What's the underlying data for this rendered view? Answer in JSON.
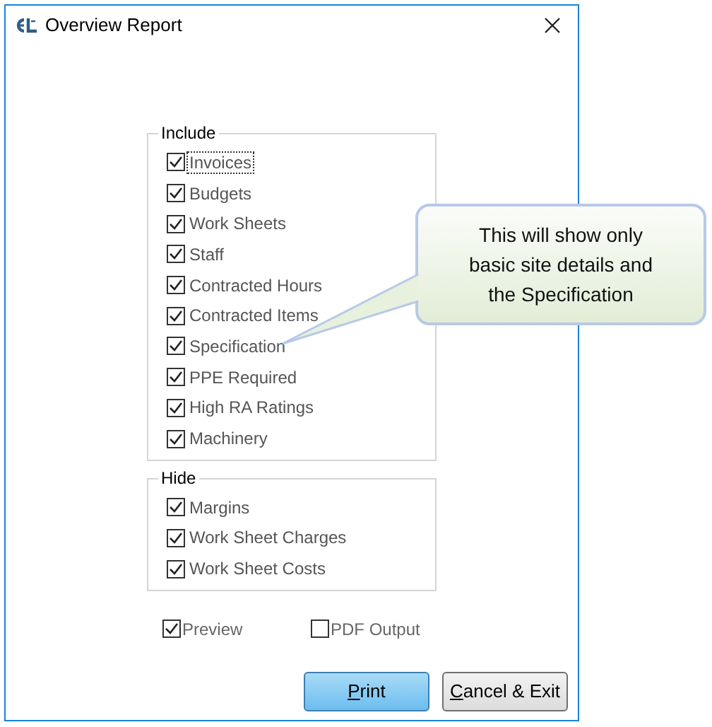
{
  "window": {
    "title": "Overview Report"
  },
  "groups": [
    {
      "title": "Include",
      "items": [
        {
          "label": "Invoices",
          "checked": true,
          "focused": true
        },
        {
          "label": "Budgets",
          "checked": true,
          "focused": false
        },
        {
          "label": "Work Sheets",
          "checked": true,
          "focused": false
        },
        {
          "label": "Staff",
          "checked": true,
          "focused": false
        },
        {
          "label": "Contracted Hours",
          "checked": true,
          "focused": false
        },
        {
          "label": "Contracted Items",
          "checked": true,
          "focused": false
        },
        {
          "label": "Specification",
          "checked": true,
          "focused": false
        },
        {
          "label": "PPE Required",
          "checked": true,
          "focused": false
        },
        {
          "label": "High RA Ratings",
          "checked": true,
          "focused": false
        },
        {
          "label": "Machinery",
          "checked": true,
          "focused": false
        }
      ]
    },
    {
      "title": "Hide",
      "items": [
        {
          "label": "Margins",
          "checked": true,
          "focused": false
        },
        {
          "label": "Work Sheet Charges",
          "checked": true,
          "focused": false
        },
        {
          "label": "Work Sheet Costs",
          "checked": true,
          "focused": false
        }
      ]
    }
  ],
  "options": [
    {
      "label": "Preview",
      "checked": true
    },
    {
      "label": "PDF Output",
      "checked": false
    }
  ],
  "buttons": [
    {
      "parts": [
        {
          "text": "P",
          "underlined": true
        },
        {
          "text": "rint",
          "underlined": false
        }
      ],
      "default": true
    },
    {
      "parts": [
        {
          "text": "C",
          "underlined": true
        },
        {
          "text": "ancel & Exit",
          "underlined": false
        }
      ],
      "default": false
    }
  ],
  "callout": {
    "text": "This will show only basic site details and the Specification"
  }
}
